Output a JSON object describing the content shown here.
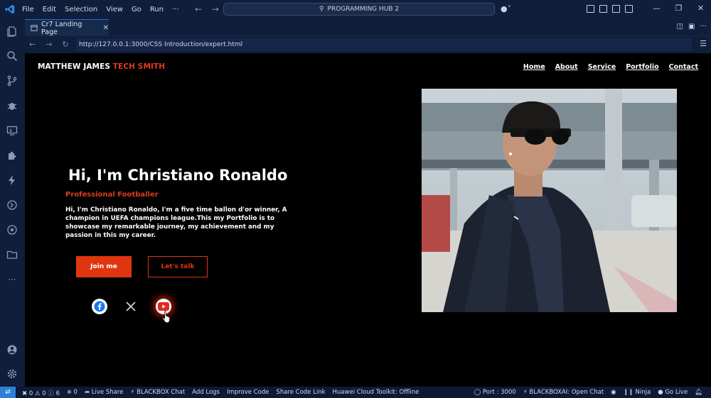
{
  "titlebar": {
    "menu": [
      "File",
      "Edit",
      "Selection",
      "View",
      "Go",
      "Run",
      "···"
    ],
    "command_center": "PROGRAMMING HUB 2"
  },
  "editor": {
    "tab_label": "Cr7 Landing Page",
    "url": "http://127.0.0.1:3000/CSS Introduction/expert.html"
  },
  "page": {
    "logo_main": "MATTHEW JAMES ",
    "logo_accent": "TECH SMITH",
    "nav": [
      "Home",
      "About",
      "Service",
      "Portfolio",
      "Contact"
    ],
    "hero_title": "Hi, I'm Christiano Ronaldo",
    "hero_subtitle": "Professional Footballer",
    "hero_description": "Hi, I'm Christiano Ronaldo, I'm a five time ballon d'or winner, A champion in UEFA champions league.This my Portfolio is to showcase my remarkable journey, my achievement and my passion in this my career.",
    "btn_join": "Join me",
    "btn_talk": "Let's talk",
    "social": [
      "facebook",
      "x",
      "youtube"
    ]
  },
  "statusbar": {
    "problems_errors": "0",
    "problems_warnings": "0",
    "info_count": "6",
    "ports_count": "0",
    "left_items": [
      "Live Share",
      "BLACKBOX Chat",
      "Add Logs",
      "Improve Code",
      "Share Code Link",
      "Huawei Cloud Toolkit: Offline"
    ],
    "right_items": [
      "Port : 3000",
      "BLACKBOXAI: Open Chat",
      "Ninja",
      "Go Live"
    ]
  },
  "colors": {
    "accent": "#e0360f",
    "titlebar_bg": "#0f1e3a",
    "page_bg": "#000000"
  }
}
